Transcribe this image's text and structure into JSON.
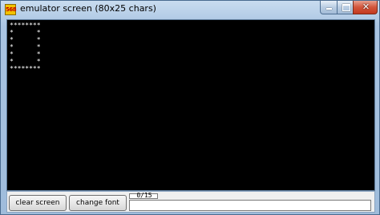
{
  "window": {
    "title": "emulator screen (80x25 chars)",
    "icon_label": "568"
  },
  "screen": {
    "lines": [
      "********",
      "*      *",
      "*      *",
      "*      *",
      "*      *",
      "*      *",
      "********"
    ]
  },
  "controls": {
    "clear_label": "clear screen",
    "font_label": "change font",
    "counter": "0/15"
  },
  "colors": {
    "screen_bg": "#000000",
    "screen_fg": "#ffffff",
    "close_button": "#c4391f"
  }
}
